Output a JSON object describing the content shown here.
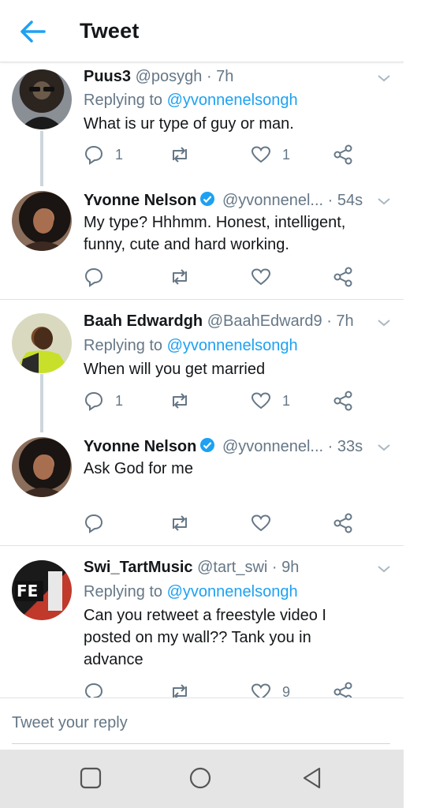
{
  "header": {
    "title": "Tweet",
    "back_icon": "back-arrow-icon"
  },
  "tweets": [
    {
      "name": "Puus3",
      "handle": "@posygh",
      "time": "· 7h",
      "verified": false,
      "replying_label": "Replying to",
      "replying_to": "@yvonnenelsongh",
      "text": "What is ur type of guy or man.",
      "reply_count": "1",
      "retweet_count": "",
      "like_count": "1"
    },
    {
      "name": "Yvonne Nelson",
      "handle": "@yvonnenel...",
      "time": "· 54s",
      "verified": true,
      "text": "My type? Hhhmm. Honest, intelligent, funny, cute and hard working.",
      "reply_count": "",
      "retweet_count": "",
      "like_count": ""
    },
    {
      "name": "Baah Edwardgh",
      "handle": "@BaahEdward9",
      "time": "· 7h",
      "verified": false,
      "replying_label": "Replying to",
      "replying_to": "@yvonnenelsongh",
      "text": "When will you get married",
      "reply_count": "1",
      "retweet_count": "",
      "like_count": "1"
    },
    {
      "name": "Yvonne Nelson",
      "handle": "@yvonnenel...",
      "time": "· 33s",
      "verified": true,
      "text": "Ask God for me",
      "reply_count": "",
      "retweet_count": "",
      "like_count": ""
    },
    {
      "name": "Swi_TartMusic",
      "handle": "@tart_swi",
      "time": "· 9h",
      "verified": false,
      "replying_label": "Replying to",
      "replying_to": "@yvonnenelsongh",
      "text": "Can you retweet a freestyle video I posted on my wall?? Tank you in advance",
      "reply_count": "",
      "retweet_count": "",
      "like_count": "9",
      "avatar_text": "FE"
    }
  ],
  "reply_box": {
    "placeholder": "Tweet your reply"
  },
  "colors": {
    "accent": "#1da1f2",
    "secondary_text": "#657786",
    "divider": "#dfe3e6",
    "navbar": "#e5e5e5"
  },
  "navbar": {
    "icons": [
      "recents-square-icon",
      "home-circle-icon",
      "back-triangle-icon"
    ]
  }
}
